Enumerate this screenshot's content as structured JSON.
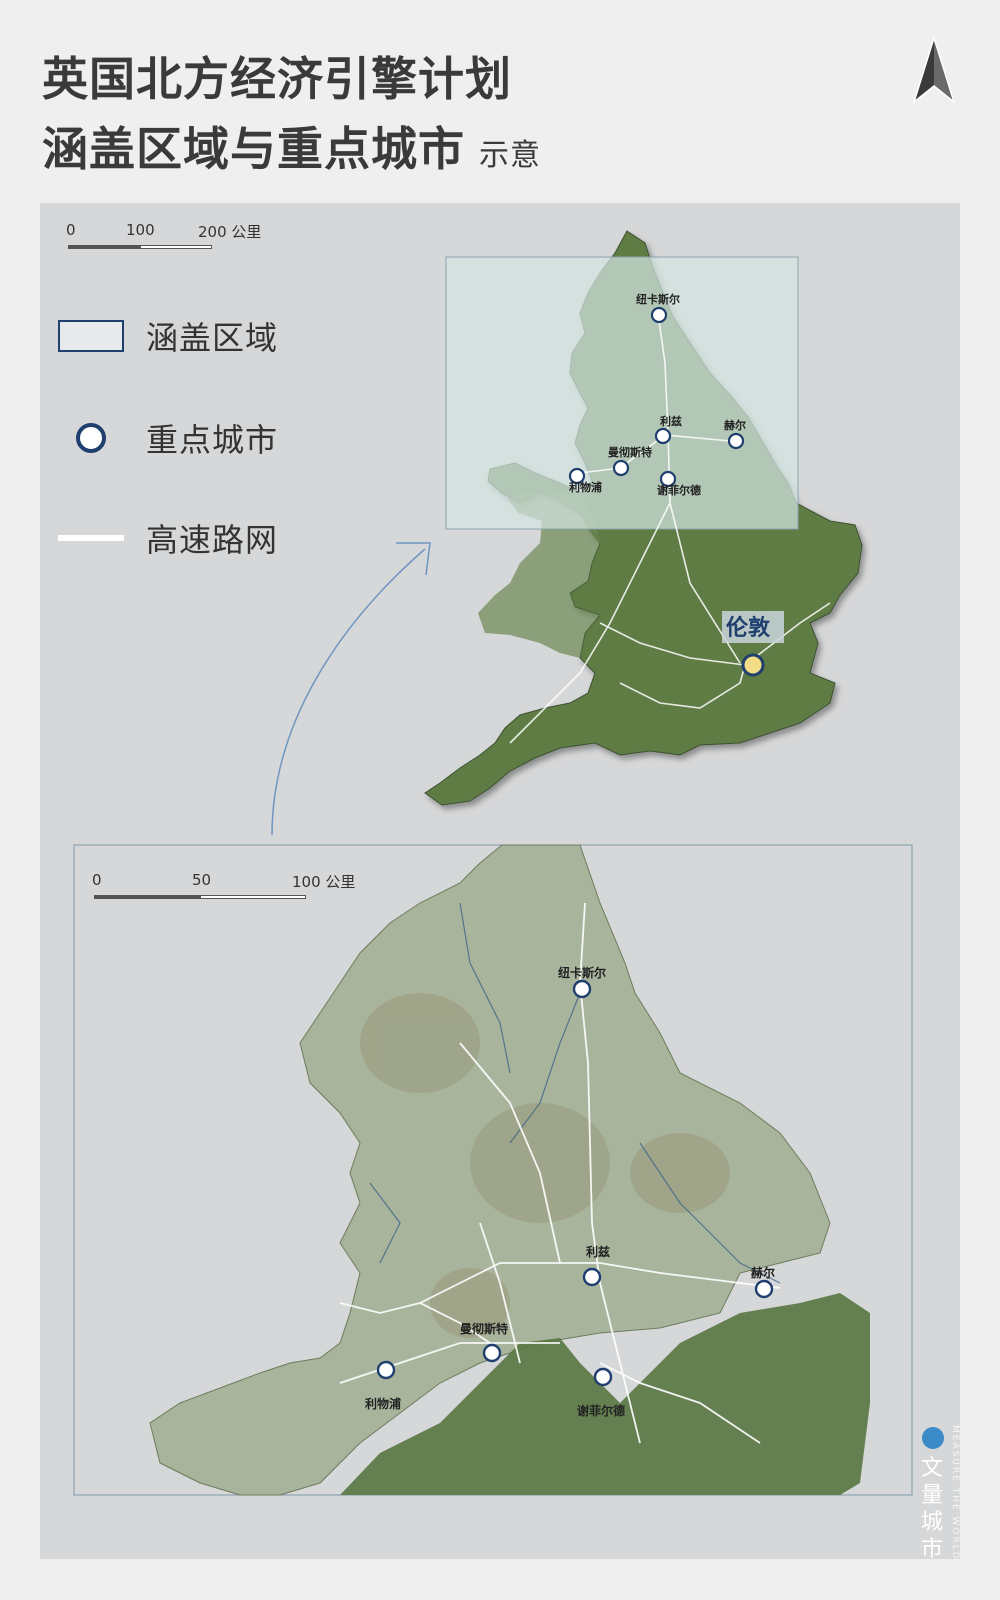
{
  "title": {
    "line1": "英国北方经济引擎计划",
    "line2": "涵盖区域与重点城市",
    "suffix": "示意"
  },
  "north_arrow": "north-arrow-icon",
  "scale_top": {
    "labels": [
      "0",
      "100",
      "200 公里"
    ]
  },
  "scale_inset": {
    "labels": [
      "0",
      "50",
      "100 公里"
    ]
  },
  "legend": {
    "area": "涵盖区域",
    "city": "重点城市",
    "road": "高速路网"
  },
  "colors": {
    "background": "#efefef",
    "panel": "#d6d7d8",
    "city_ring": "#1f3f6e",
    "area_fill": "#cfe0dd",
    "london_fill": "#f3dc86",
    "land_green": "#5d7a46",
    "land_pale": "#a7b39a"
  },
  "top_map": {
    "capital": "伦敦",
    "cities": [
      "纽卡斯尔",
      "利兹",
      "赫尔",
      "曼彻斯特",
      "利物浦",
      "谢菲尔德"
    ]
  },
  "inset_map": {
    "cities": [
      "纽卡斯尔",
      "利兹",
      "赫尔",
      "曼彻斯特",
      "利物浦",
      "谢菲尔德"
    ]
  },
  "brand": {
    "name": "文量城市",
    "tagline": "MEASURE THE WORLD"
  }
}
